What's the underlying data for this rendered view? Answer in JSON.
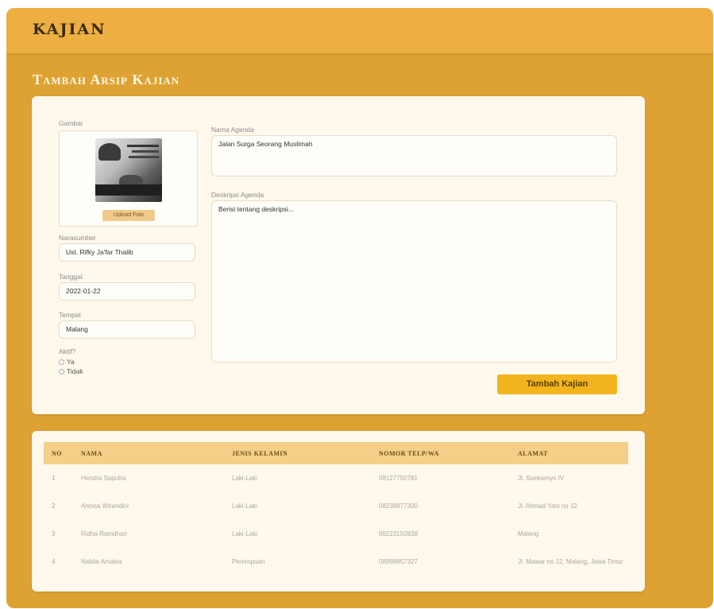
{
  "app": {
    "brand": "KAJIAN"
  },
  "page": {
    "section_title": "Tambah Arsip Kajian"
  },
  "form": {
    "gambar_label": "Gambar",
    "upload_button": "Upload Foto",
    "narasumber_label": "Narasumber",
    "narasumber_value": "Ust. Rifky Ja'far Thalib",
    "tanggal_label": "Tanggal",
    "tanggal_value": "2022-01-22",
    "tempat_label": "Tempat",
    "tempat_value": "Malang",
    "aktif_label": "Aktif?",
    "aktif_options": [
      "Ya",
      "Tidak"
    ],
    "nama_agenda_label": "Nama Agenda",
    "nama_agenda_value": "Jalan Surga Seorang Muslimah",
    "deskripsi_label": "Deskripsi Agenda",
    "deskripsi_value": "Berisi tentang deskripsi...",
    "submit_label": "Tambah Kajian"
  },
  "table": {
    "headers": [
      "NO",
      "NAMA",
      "JENIS KELAMIN",
      "NOMOR TELP/WA",
      "ALAMAT"
    ],
    "rows": [
      [
        "1",
        "Hendra Saputra",
        "Laki-Laki",
        "08127750781",
        "Jl. Soekarnyo IV"
      ],
      [
        "2",
        "Annisa Wirandini",
        "Laki-Laki",
        "08238877300",
        "Jl. Ahmad Yani no 12"
      ],
      [
        "3",
        "Ridha Ramdhan",
        "Laki-Laki",
        "08223150838",
        "Malang"
      ],
      [
        "4",
        "Nabila Amalea",
        "Perempuan",
        "08998857327",
        "Jl. Mawar no 12, Malang, Jawa Timur"
      ]
    ]
  },
  "colors": {
    "background": "#dea233",
    "topbar": "#edae42",
    "card": "#fff8ec",
    "table_header": "#f4cf87",
    "primary_button": "#f2b51d"
  }
}
